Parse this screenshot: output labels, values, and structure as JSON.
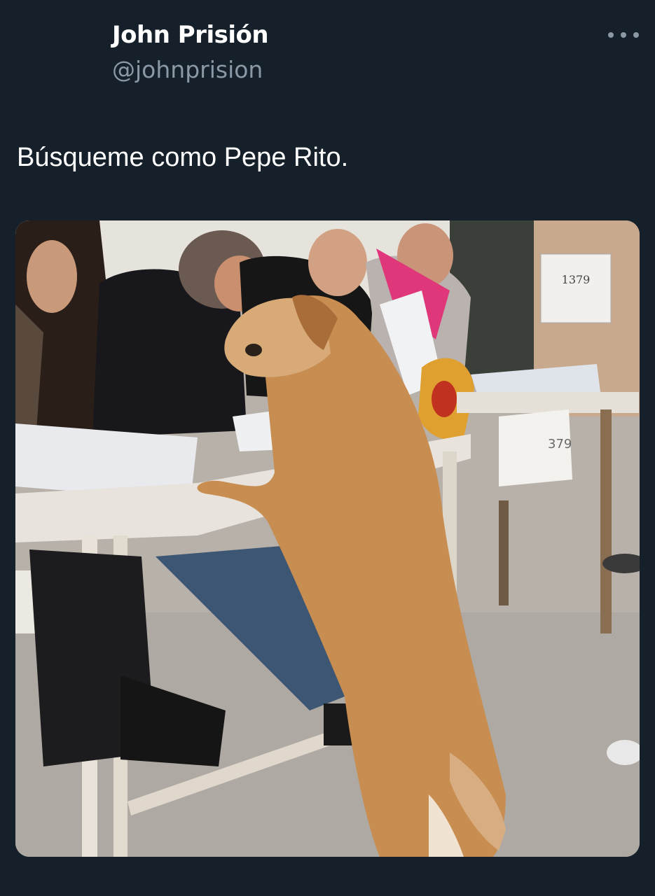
{
  "tweet": {
    "display_name": "John Prisión",
    "handle": "@johnprision",
    "text": "Búsqueme como Pepe Rito.",
    "more_icon": "more-horizontal-icon"
  },
  "photo": {
    "sign_text": "1379",
    "tag_text": "379"
  },
  "colors": {
    "background": "#15202b",
    "secondary_text": "#8b98a5"
  }
}
